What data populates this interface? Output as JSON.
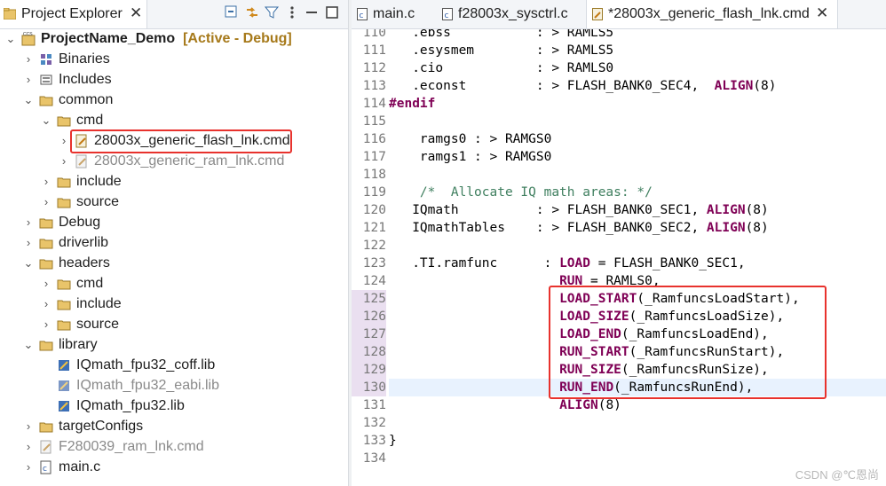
{
  "explorer": {
    "title": "Project Explorer",
    "close": "✕",
    "items": [
      {
        "label": "ProjectName_Demo",
        "tag": "[Active - Debug]"
      },
      {
        "label": "Binaries"
      },
      {
        "label": "Includes"
      },
      {
        "label": "common"
      },
      {
        "label": "cmd"
      },
      {
        "label": "28003x_generic_flash_lnk.cmd"
      },
      {
        "label": "28003x_generic_ram_lnk.cmd"
      },
      {
        "label": "include"
      },
      {
        "label": "source"
      },
      {
        "label": "Debug"
      },
      {
        "label": "driverlib"
      },
      {
        "label": "headers"
      },
      {
        "label": "cmd"
      },
      {
        "label": "include"
      },
      {
        "label": "source"
      },
      {
        "label": "library"
      },
      {
        "label": "IQmath_fpu32_coff.lib"
      },
      {
        "label": "IQmath_fpu32_eabi.lib"
      },
      {
        "label": "IQmath_fpu32.lib"
      },
      {
        "label": "targetConfigs"
      },
      {
        "label": "F280039_ram_lnk.cmd"
      },
      {
        "label": "main.c"
      }
    ]
  },
  "editor": {
    "tabs": [
      {
        "label": "main.c"
      },
      {
        "label": "f28003x_sysctrl.c"
      },
      {
        "label": "*28003x_generic_flash_lnk.cmd",
        "close": "✕"
      }
    ],
    "lines": [
      {
        "n": "110",
        "pre": "   .ebss           : > RAMLS5",
        "kw": "",
        "post": ""
      },
      {
        "n": "111",
        "pre": "   .esysmem        : > RAMLS5",
        "kw": "",
        "post": ""
      },
      {
        "n": "112",
        "pre": "   .cio            : > RAMLS0",
        "kw": "",
        "post": ""
      },
      {
        "n": "113",
        "pre": "   .econst         : > FLASH_BANK0_SEC4,  ",
        "kw": "ALIGN",
        "post": "(8)"
      },
      {
        "n": "114",
        "pre": "",
        "kw": "#endif",
        "post": ""
      },
      {
        "n": "115",
        "pre": "",
        "kw": "",
        "post": ""
      },
      {
        "n": "116",
        "pre": "    ramgs0 : > RAMGS0",
        "kw": "",
        "post": ""
      },
      {
        "n": "117",
        "pre": "    ramgs1 : > RAMGS0",
        "kw": "",
        "post": ""
      },
      {
        "n": "118",
        "pre": "",
        "kw": "",
        "post": ""
      },
      {
        "n": "119",
        "pre": "    ",
        "cm": "/*  Allocate IQ math areas: */",
        "kw": "",
        "post": ""
      },
      {
        "n": "120",
        "pre": "   IQmath          : > FLASH_BANK0_SEC1, ",
        "kw": "ALIGN",
        "post": "(8)"
      },
      {
        "n": "121",
        "pre": "   IQmathTables    : > FLASH_BANK0_SEC2, ",
        "kw": "ALIGN",
        "post": "(8)"
      },
      {
        "n": "122",
        "pre": "",
        "kw": "",
        "post": ""
      },
      {
        "n": "123",
        "pre": "   .TI.ramfunc      : ",
        "kw": "LOAD",
        "post": " = FLASH_BANK0_SEC1,"
      },
      {
        "n": "124",
        "pre": "                      ",
        "kw": "RUN",
        "post": " = RAMLS0,"
      },
      {
        "n": "125",
        "pre": "                      ",
        "kw": "LOAD_START",
        "post": "(_RamfuncsLoadStart),"
      },
      {
        "n": "126",
        "pre": "                      ",
        "kw": "LOAD_SIZE",
        "post": "(_RamfuncsLoadSize),"
      },
      {
        "n": "127",
        "pre": "                      ",
        "kw": "LOAD_END",
        "post": "(_RamfuncsLoadEnd),"
      },
      {
        "n": "128",
        "pre": "                      ",
        "kw": "RUN_START",
        "post": "(_RamfuncsRunStart),"
      },
      {
        "n": "129",
        "pre": "                      ",
        "kw": "RUN_SIZE",
        "post": "(_RamfuncsRunSize),"
      },
      {
        "n": "130",
        "pre": "                      ",
        "kw": "RUN_END",
        "post": "(_RamfuncsRunEnd),"
      },
      {
        "n": "131",
        "pre": "                      ",
        "kw": "ALIGN",
        "post": "(8)"
      },
      {
        "n": "132",
        "pre": "",
        "kw": "",
        "post": ""
      },
      {
        "n": "133",
        "pre": "}",
        "kw": "",
        "post": ""
      },
      {
        "n": "134",
        "pre": "",
        "kw": "",
        "post": ""
      }
    ]
  },
  "watermark": "CSDN @℃恩尚",
  "colors": {
    "keyword": "#7f0055",
    "comment": "#3f7f5f",
    "highlight_box": "#e8322d",
    "active_tag": "#a6791a"
  }
}
